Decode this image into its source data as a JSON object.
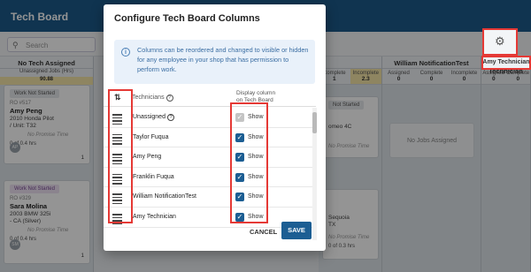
{
  "app": {
    "title": "Tech Board",
    "search_placeholder": "Search",
    "gear_icon": "gear-icon"
  },
  "columns": [
    {
      "name": "No Tech Assigned",
      "sub": "Unassigned Jobs (Hrs)",
      "sub_value": "90.88",
      "cards": [
        {
          "badge": "Work Not Started",
          "ro": "RO #517",
          "name": "Amy Peng",
          "car": "2010 Honda Pilot",
          "unit": "/ Unit: T32",
          "avatar": "AP",
          "promise": "No Promise Time",
          "foot": "0 of 0.4 hrs",
          "count": "1"
        },
        {
          "badge": "Work Not Started",
          "ro": "RO #329",
          "name": "Sara Molina",
          "car": "2003 BMW 325i",
          "unit": "- CA (Silver)",
          "avatar": "SM",
          "promise": "No Promise Time",
          "foot": "0 of 0.4 hrs",
          "count": "1"
        }
      ]
    },
    {
      "name": "William NotificationTest",
      "stats": [
        [
          "Assigned",
          "0"
        ],
        [
          "Complete",
          "0"
        ],
        [
          "Incomplete",
          "0"
        ]
      ],
      "empty": "No Jobs Assigned"
    },
    {
      "name": "Amy Technician",
      "stats": [
        [
          "Assigned",
          "0"
        ],
        [
          "Complete",
          "0"
        ]
      ]
    }
  ],
  "mid_stats": {
    "complete": "Complete",
    "incomplete": "Incomplete",
    "val1": "1",
    "val2": "2.3"
  },
  "peek": {
    "badge": "Not Started",
    "car1": "omeo 4C",
    "promise": "No Promise Time",
    "car2": "Sequoia",
    "car3": "TX",
    "promise2": "No Promise Time",
    "foot": "0 of 0.3 hrs"
  },
  "dialog": {
    "title": "Configure Tech Board Columns",
    "info": "Columns can be reordered and changed to visible or hidden for any employee in your shop that has permission to perform work.",
    "header_technicians": "Technicians",
    "header_display_1": "Display column",
    "header_display_2": "on Tech Board",
    "rows": [
      {
        "name": "Unassigned",
        "help": true,
        "checked": true,
        "disabled": true,
        "label": "Show"
      },
      {
        "name": "Taylor Fuqua",
        "help": false,
        "checked": true,
        "disabled": false,
        "label": "Show"
      },
      {
        "name": "Amy Peng",
        "help": false,
        "checked": true,
        "disabled": false,
        "label": "Show"
      },
      {
        "name": "Franklin Fuqua",
        "help": false,
        "checked": true,
        "disabled": false,
        "label": "Show"
      },
      {
        "name": "William NotificationTest",
        "help": false,
        "checked": true,
        "disabled": false,
        "label": "Show"
      },
      {
        "name": "Amy Technician",
        "help": false,
        "checked": true,
        "disabled": false,
        "label": "Show"
      }
    ],
    "cancel": "CANCEL",
    "save": "SAVE"
  }
}
